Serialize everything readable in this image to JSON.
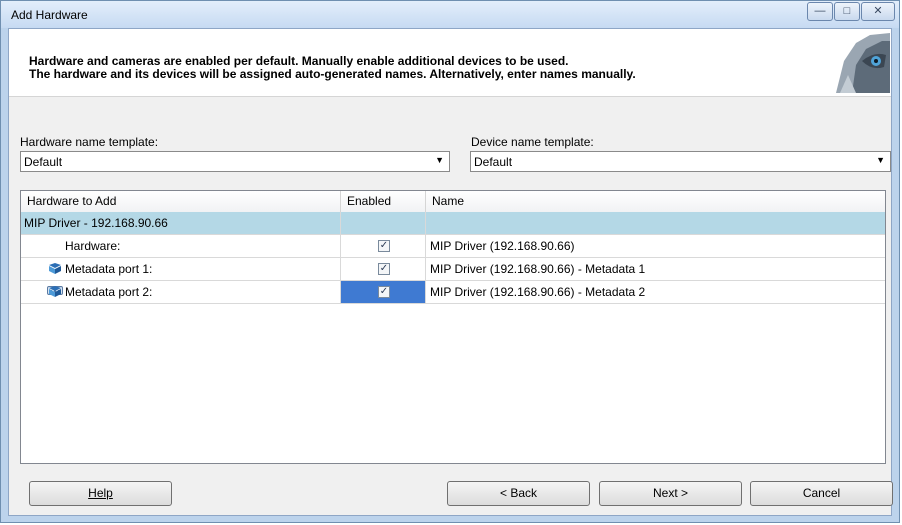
{
  "window": {
    "title": "Add Hardware"
  },
  "banner": {
    "line1": "Hardware and cameras are enabled per default. Manually enable additional devices to be used.",
    "line2": "The hardware and its devices will be assigned auto-generated names. Alternatively, enter names manually."
  },
  "templates": {
    "hardware_label": "Hardware name template:",
    "hardware_value": "Default",
    "device_label": "Device name template:",
    "device_value": "Default"
  },
  "grid": {
    "columns": [
      "Hardware to Add",
      "Enabled",
      "Name"
    ],
    "group": {
      "label": "MIP Driver - 192.168.90.66"
    },
    "rows": [
      {
        "label": "Hardware:",
        "icon": "hardware-icon",
        "enabled": true,
        "name": "MIP Driver (192.168.90.66)"
      },
      {
        "label": "Metadata port 1:",
        "icon": "metadata-icon",
        "enabled": true,
        "name": "MIP Driver (192.168.90.66) - Metadata 1"
      },
      {
        "label": "Metadata port 2:",
        "icon": "metadata-icon",
        "enabled": true,
        "name": "MIP Driver (192.168.90.66) - Metadata 2"
      }
    ]
  },
  "buttons": {
    "help": "Help",
    "back": "< Back",
    "next": "Next >",
    "cancel": "Cancel"
  },
  "colors": {
    "selection": "#3f7ad2",
    "group_row": "#b4d8e6",
    "titlebar": "#c6daf2"
  }
}
